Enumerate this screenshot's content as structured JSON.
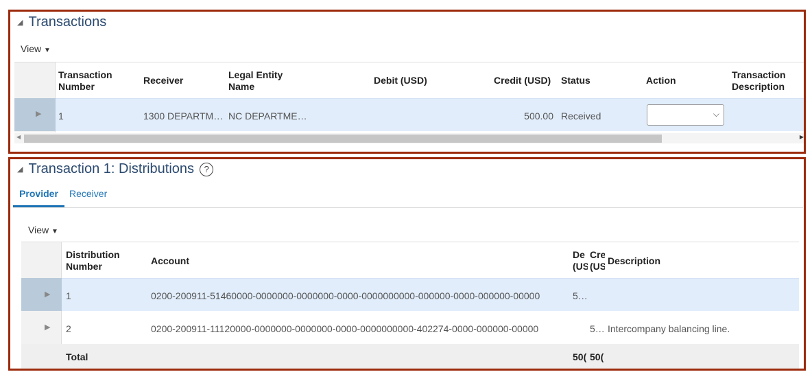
{
  "transactions": {
    "title": "Transactions",
    "view_label": "View",
    "columns": [
      "Transaction Number",
      "Receiver",
      "Legal Entity Name",
      "Debit (USD)",
      "Credit (USD)",
      "Status",
      "Action",
      "Transaction Description"
    ],
    "columns_lines": [
      [
        "Transaction",
        "Number"
      ],
      [
        "Receiver"
      ],
      [
        "Legal Entity",
        "Name"
      ],
      [
        "Debit (USD)"
      ],
      [
        "Credit (USD)"
      ],
      [
        "Status"
      ],
      [
        "Action"
      ],
      [
        "Transaction",
        "Description"
      ]
    ],
    "rows": [
      {
        "number": "1",
        "receiver": "1300 DEPARTM…",
        "legal_entity": "NC DEPARTME…",
        "debit": "",
        "credit": "500.00",
        "status": "Received",
        "action": ""
      }
    ]
  },
  "distributions": {
    "title": "Transaction 1: Distributions",
    "tabs": [
      "Provider",
      "Receiver"
    ],
    "view_label": "View",
    "columns": {
      "number": [
        "Distribution",
        "Number"
      ],
      "account": "Account",
      "debit": [
        "De",
        "(US"
      ],
      "credit": [
        "Cre",
        "(US"
      ],
      "description": "Description"
    },
    "rows": [
      {
        "number": "1",
        "account": "0200-200911-51460000-0000000-0000000-0000-0000000000-000000-0000-000000-00000",
        "debit": "5…",
        "credit": "",
        "description": ""
      },
      {
        "number": "2",
        "account": "0200-200911-11120000-0000000-0000000-0000-0000000000-402274-0000-000000-00000",
        "debit": "",
        "credit": "5…",
        "description": "Intercompany balancing line."
      }
    ],
    "total": {
      "label": "Total",
      "debit": "50(",
      "credit": "50("
    }
  }
}
